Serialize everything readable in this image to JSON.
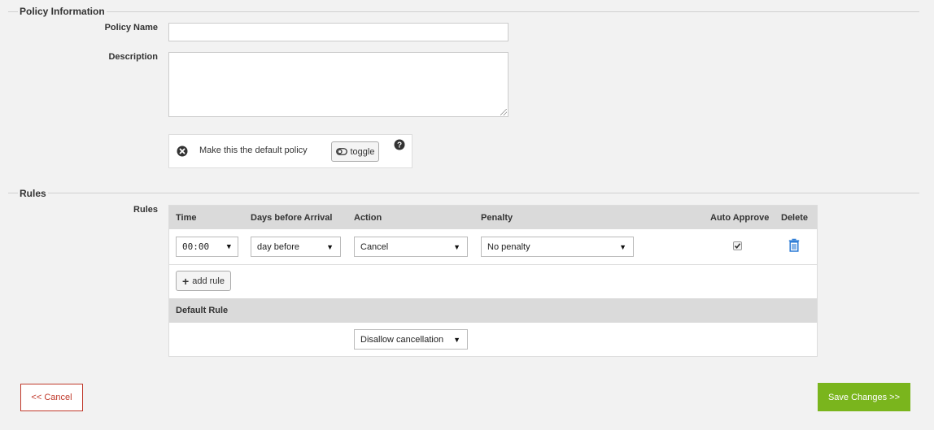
{
  "policy_info": {
    "legend": "Policy Information",
    "name_label": "Policy Name",
    "name_value": "",
    "description_label": "Description",
    "description_value": "",
    "default_text": "Make this the default policy",
    "toggle_label": "toggle"
  },
  "rules": {
    "legend": "Rules",
    "label": "Rules",
    "headers": {
      "time": "Time",
      "days": "Days before Arrival",
      "action": "Action",
      "penalty": "Penalty",
      "auto_approve": "Auto Approve",
      "delete": "Delete"
    },
    "row": {
      "time": "00:00",
      "days": "day before",
      "action": "Cancel",
      "penalty": "No penalty",
      "auto_approve_checked": true
    },
    "add_rule_label": "add rule",
    "default_rule_header": "Default Rule",
    "default_rule_value": "Disallow cancellation"
  },
  "footer": {
    "cancel_label": "<< Cancel",
    "save_label": "Save Changes >>"
  }
}
